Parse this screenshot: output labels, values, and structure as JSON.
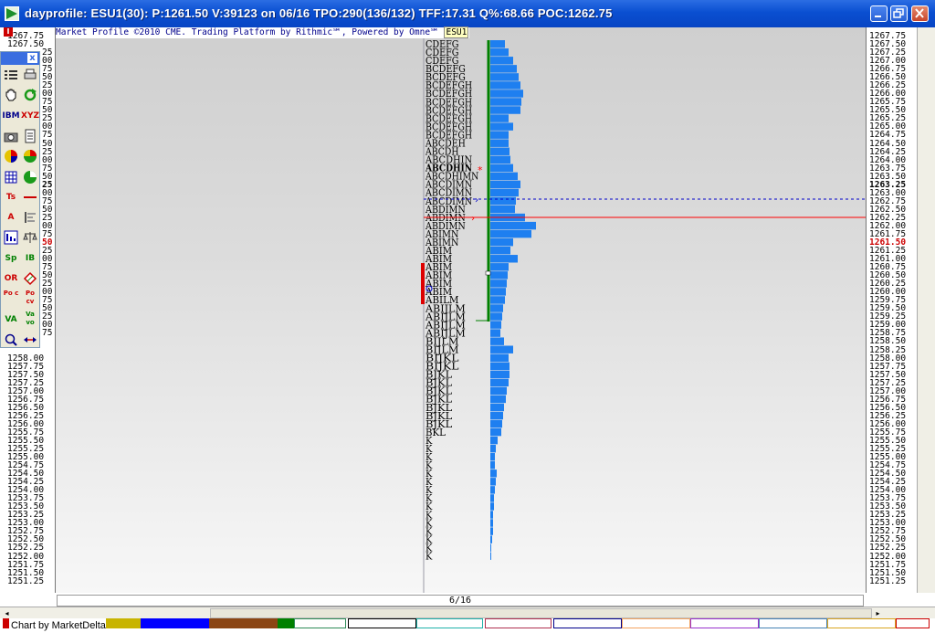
{
  "window": {
    "title": "dayprofile: ESU1(30): P:1261.50 V:39123 on 06/16 TPO:290(136/132)  TFF:17.31 Q%:68.66 POC:1262.75"
  },
  "banner": {
    "text": "Market Profile ©2010 CME. Trading Platform by Rithmic℠, Powered by Omne℠",
    "symbol": "ESU1"
  },
  "left_axis": {
    "marker": "I",
    "labels": [
      "1267.75",
      "1267.50",
      "1258.00",
      "1257.75",
      "1257.50",
      "1257.25",
      "1257.00",
      "1256.75",
      "1256.50",
      "1256.25",
      "1256.00",
      "1255.75",
      "1255.50",
      "1255.25",
      "1255.00",
      "1254.75",
      "1254.50",
      "1254.25",
      "1254.00",
      "1253.75",
      "1253.50",
      "1253.25",
      "1253.00",
      "1252.75",
      "1252.50",
      "1252.25",
      "1252.00",
      "1251.75",
      "1251.50",
      "1251.25"
    ],
    "partial_labels": [
      "25",
      "00",
      "75",
      "50",
      "25",
      "00",
      "75",
      "50",
      "25",
      "00",
      "75",
      "50",
      "25",
      "00",
      "75",
      "50",
      "25",
      "00",
      "75",
      "50",
      "25",
      "00",
      "75",
      "50",
      "25",
      "00",
      "75",
      "50",
      "25",
      "00",
      "75",
      "50",
      "25",
      "00",
      "75"
    ]
  },
  "right_axis": {
    "marker": "M",
    "labels": [
      "1267.75",
      "1267.50",
      "1267.25",
      "1267.00",
      "1266.75",
      "1266.50",
      "1266.25",
      "1266.00",
      "1265.75",
      "1265.50",
      "1265.25",
      "1265.00",
      "1264.75",
      "1264.50",
      "1264.25",
      "1264.00",
      "1263.75",
      "1263.50",
      "1263.25",
      "1263.00",
      "1262.75",
      "1262.50",
      "1262.25",
      "1262.00",
      "1261.75",
      "1261.50",
      "1261.25",
      "1261.00",
      "1260.75",
      "1260.50",
      "1260.25",
      "1260.00",
      "1259.75",
      "1259.50",
      "1259.25",
      "1259.00",
      "1258.75",
      "1258.50",
      "1258.25",
      "1258.00",
      "1257.75",
      "1257.50",
      "1257.25",
      "1257.00",
      "1256.75",
      "1256.50",
      "1256.25",
      "1256.00",
      "1255.75",
      "1255.50",
      "1255.25",
      "1255.00",
      "1254.75",
      "1254.50",
      "1254.25",
      "1254.00",
      "1253.75",
      "1253.50",
      "1253.25",
      "1253.00",
      "1252.75",
      "1252.50",
      "1252.25",
      "1252.00",
      "1251.75",
      "1251.50",
      "1251.25"
    ],
    "highlight_price": "1263.25",
    "last_price": "1261.50"
  },
  "profile": {
    "letters": [
      "CDEFG",
      "CDEFG",
      "CDEFG",
      "BCDEFG",
      "BCDEFG",
      "BCDEFGH",
      "BCDEFGH",
      "BCDEFGH",
      "BCDEFGH",
      "BCDEFGH",
      "BCDEFGH",
      "BCDEFGH",
      "ABCDEH",
      "ABCDH",
      "ABCDHIN",
      "ABCDHIN",
      "ABCDHIMN",
      "ABCDIMN",
      "ABCDIMN",
      "ABCDIMN",
      "ABDIMN",
      "ABDIMN",
      "ABDIMN",
      "ABIMN",
      "ABIMN",
      "ABIM",
      "ABIM",
      "ABIM",
      "ABIM",
      "ABIM",
      "ABIM",
      "ABILM",
      "ABIJLM",
      "ABIJLM",
      "ABIJLM",
      "ABIJLM",
      "BIJLM",
      "BIJLM",
      "BIJKL",
      "BIJKL",
      "BJKL",
      "BJKL",
      "BJKL",
      "BJKL",
      "BJKL",
      "BJKL",
      "BJKL",
      "BKL",
      "K",
      "K",
      "K",
      "K",
      "K",
      "K",
      "K",
      "K",
      "K",
      "K",
      "K",
      "K",
      "K",
      "K",
      "K"
    ],
    "volumes": [
      16,
      20,
      25,
      29,
      31,
      33,
      36,
      34,
      33,
      20,
      25,
      20,
      20,
      21,
      22,
      25,
      30,
      33,
      31,
      28,
      27,
      38,
      50,
      45,
      25,
      22,
      30,
      20,
      19,
      18,
      17,
      16,
      14,
      13,
      12,
      11,
      15,
      25,
      20,
      21,
      21,
      20,
      18,
      17,
      15,
      14,
      13,
      12,
      8,
      6,
      5,
      5,
      7,
      6,
      5,
      4,
      4,
      3,
      3,
      3,
      2,
      1,
      1
    ]
  },
  "date_bar": {
    "date": "6/16"
  },
  "status": {
    "text": "Chart by MarketDelta"
  },
  "colors": {
    "profile_bar": "#1e7ff0",
    "va_line": "#008000",
    "poc_line": "#ff0000",
    "price_line": "#0000cc"
  },
  "toolbar": {
    "close_label": "x",
    "tools": [
      "list-icon",
      "print-icon",
      "hand-icon",
      "refresh-icon",
      "ibm-icon",
      "xyz-icon",
      "camera-icon",
      "notes-icon",
      "color-wheel-icon",
      "color-wheel-2-icon",
      "grid-icon",
      "pie-icon",
      "ts-icon",
      "line-icon",
      "text-icon",
      "align-icon",
      "chart-icon",
      "scale-icon",
      "sp-icon",
      "ib-icon",
      "or-icon",
      "diamond-icon",
      "poc-icon",
      "pocv-icon",
      "va-icon",
      "vavo-icon",
      "search-icon",
      "arrows-icon"
    ],
    "tool_labels": {
      "ibm-icon": "IBM",
      "xyz-icon": "XYZ",
      "ts-icon": "Ts",
      "text-icon": "A",
      "sp-icon": "Sp",
      "ib-icon": "IB",
      "or-icon": "OR",
      "poc-icon": "Po c",
      "pocv-icon": "Po cv",
      "va-icon": "VA",
      "vavo-icon": "Va vo"
    }
  }
}
